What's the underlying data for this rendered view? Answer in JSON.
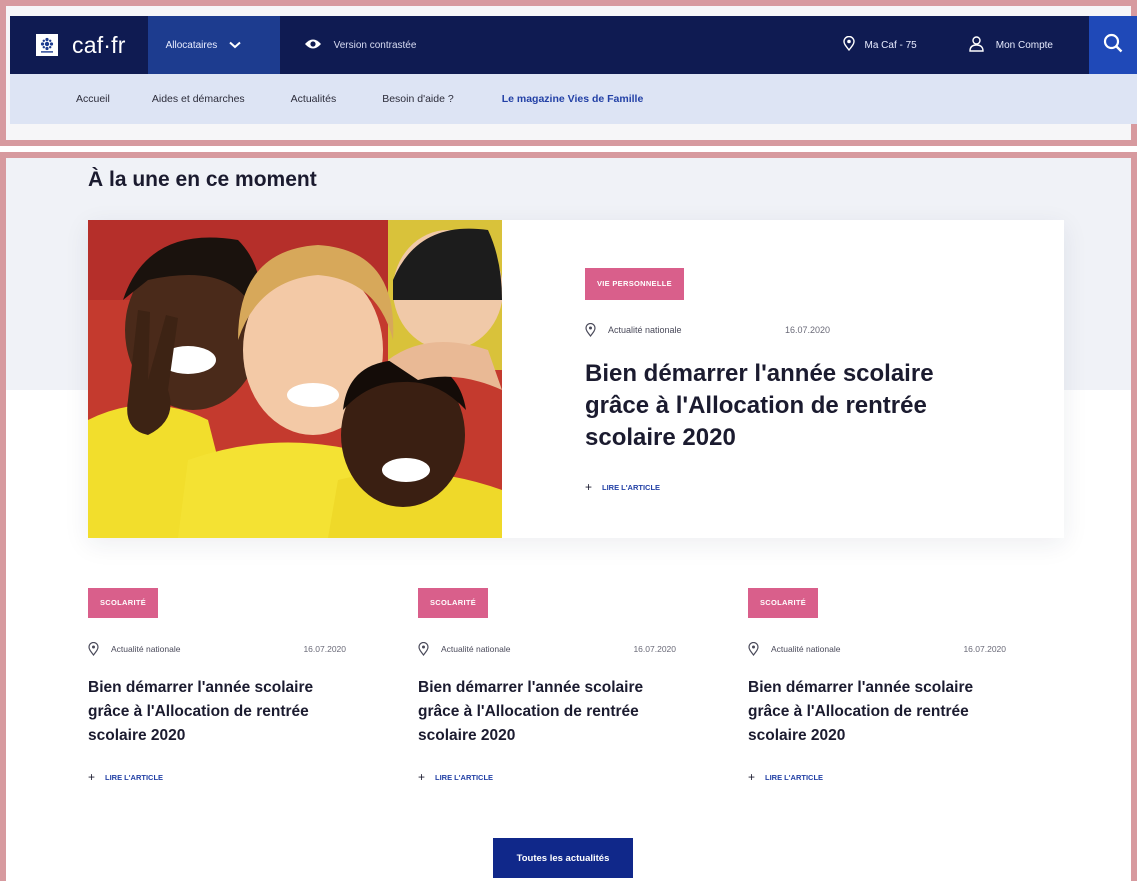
{
  "header": {
    "brand": "caf·fr",
    "audience_label": "Allocataires",
    "contrast_label": "Version contrastée",
    "ma_caf_label": "Ma Caf - 75",
    "account_label": "Mon Compte"
  },
  "nav": {
    "items": [
      {
        "label": "Accueil"
      },
      {
        "label": "Aides et démarches"
      },
      {
        "label": "Actualités"
      },
      {
        "label": "Besoin d'aide ?"
      },
      {
        "label": "Le magazine Vies de Famille"
      }
    ]
  },
  "main": {
    "section_title": "À la une en ce moment",
    "featured": {
      "tag": "Vie personnelle",
      "location": "Actualité nationale",
      "date": "16.07.2020",
      "title": "Bien démarrer l'année scolaire grâce à l'Allocation de rentrée scolaire 2020",
      "read_more": "Lire l'article"
    },
    "cards": [
      {
        "tag": "Scolarité",
        "location": "Actualité nationale",
        "date": "16.07.2020",
        "title": "Bien démarrer l'année scolaire grâce à l'Allocation de rentrée scolaire 2020",
        "read_more": "Lire l'article"
      },
      {
        "tag": "Scolarité",
        "location": "Actualité nationale",
        "date": "16.07.2020",
        "title": "Bien démarrer l'année scolaire grâce à l'Allocation de rentrée scolaire 2020",
        "read_more": "Lire l'article"
      },
      {
        "tag": "Scolarité",
        "location": "Actualité nationale",
        "date": "16.07.2020",
        "title": "Bien démarrer l'année scolaire grâce à l'Allocation de rentrée scolaire 2020",
        "read_more": "Lire l'article"
      }
    ],
    "all_news_label": "Toutes les actualités"
  },
  "colors": {
    "header_navy": "#0f1b52",
    "audience_blue": "#1d3c8f",
    "nav_bg": "#dde4f4",
    "tag_pink": "#d95f8b",
    "link_blue": "#2341a6",
    "button_blue": "#10288a"
  },
  "icons": {
    "logo": "caf-logo-icon",
    "audience_chevron": "chevron-down-icon",
    "contrast": "eye-icon",
    "ma_caf": "location-pin-icon",
    "account": "user-icon",
    "search": "search-icon",
    "meta_location": "location-pin-icon",
    "read_more": "plus-icon"
  }
}
